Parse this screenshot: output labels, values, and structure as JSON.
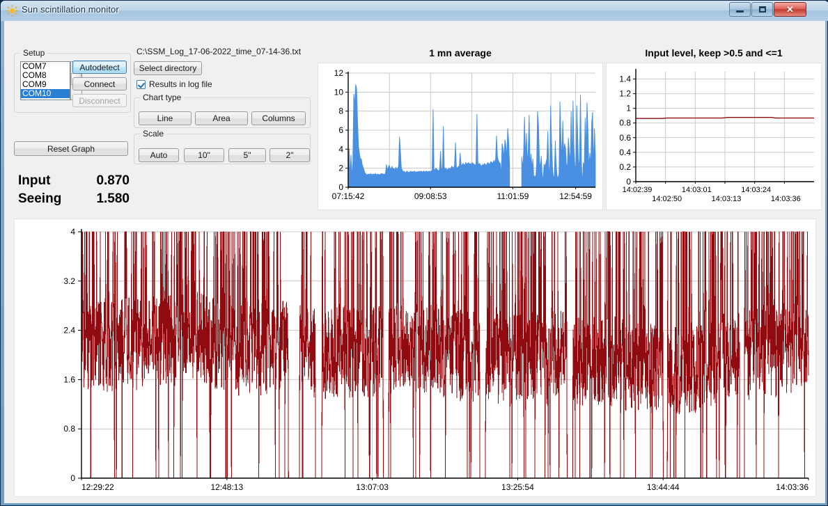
{
  "window": {
    "title": "Sun scintillation monitor",
    "icon": "sun-icon",
    "buttons": {
      "minimize": "minimize",
      "maximize": "maximize",
      "close": "close"
    }
  },
  "setup": {
    "group_label": "Setup",
    "ports": [
      "COM7",
      "COM8",
      "COM9",
      "COM10"
    ],
    "selected_port": "COM10",
    "autodetect_label": "Autodetect",
    "connect_label": "Connect",
    "disconnect_label": "Disconnect",
    "reset_graph_label": "Reset Graph"
  },
  "logging": {
    "path": "C:\\SSM_Log_17-06-2022_time_07-14-36.txt",
    "select_directory_label": "Select directory",
    "results_checkbox_label": "Results in log file",
    "results_checked": true
  },
  "chart_type": {
    "group_label": "Chart type",
    "buttons": [
      "Line",
      "Area",
      "Columns"
    ]
  },
  "scale": {
    "group_label": "Scale",
    "buttons": [
      "Auto",
      "10\"",
      "5\"",
      "2\""
    ]
  },
  "readouts": [
    {
      "label": "Input",
      "value": "0.870"
    },
    {
      "label": "Seeing",
      "value": "1.580"
    }
  ],
  "colors": {
    "series_blue": "#4a90e2",
    "series_darkred": "#8f0b10",
    "grid": "#c8c8c8",
    "axis": "#000000",
    "panel_bg": "#ffffff",
    "window_bg": "#f0f0f0",
    "selection": "#2a7fd4",
    "focus_border": "#3c7fb1"
  },
  "chart_data": [
    {
      "id": "one-minute-average",
      "type": "area",
      "title": "1 mn average",
      "xlabel": "",
      "ylabel": "",
      "ylim": [
        0,
        12
      ],
      "yticks": [
        0,
        2,
        4,
        6,
        8,
        10,
        12
      ],
      "xticks": [
        "07:15:42",
        "09:08:53",
        "11:01:59",
        "12:54:59"
      ],
      "xtick_positions": [
        0.0,
        0.333,
        0.666,
        0.92
      ],
      "grid": true,
      "color": "#4a90e2",
      "x_range": [
        "07:15:42",
        "13:45:00"
      ],
      "values": [
        0.6,
        4.1,
        1.2,
        3.4,
        1.0,
        2.7,
        9.8,
        8.6,
        10.8,
        10.4,
        7.2,
        4.3,
        3.6,
        2.9,
        3.0,
        2.4,
        2.1,
        1.8,
        1.5,
        1.4,
        1.3,
        1.35,
        1.4,
        1.3,
        1.45,
        1.3,
        1.35,
        1.4,
        1.3,
        1.45,
        1.35,
        1.3,
        1.4,
        1.3,
        1.35,
        1.4,
        1.45,
        1.35,
        1.4,
        1.3,
        1.5,
        2.4,
        1.8,
        2.1,
        2.3,
        2.0,
        1.9,
        2.2,
        1.9,
        2.0,
        1.8,
        2.1,
        1.9,
        2.0,
        2.2,
        5.3,
        3.8,
        2.0,
        1.8,
        1.6,
        1.7,
        1.5,
        1.6,
        1.7,
        1.6,
        1.55,
        1.6,
        1.7,
        1.6,
        1.65,
        1.6,
        1.7,
        1.6,
        1.55,
        1.65,
        1.6,
        1.7,
        1.6,
        1.7,
        1.65,
        1.6,
        1.7,
        1.6,
        1.65,
        1.7,
        1.6,
        1.65,
        1.7,
        1.6,
        1.7,
        1.8,
        8.2,
        1.9,
        1.8,
        2.0,
        1.9,
        1.8,
        1.7,
        1.9,
        3.8,
        2.0,
        1.9,
        6.4,
        2.1,
        1.9,
        2.0,
        1.8,
        1.9,
        2.0,
        1.9,
        2.0,
        2.2,
        2.1,
        2.0,
        2.3,
        4.7,
        2.1,
        2.0,
        2.2,
        2.1,
        3.6,
        2.4,
        2.3,
        2.5,
        2.4,
        2.3,
        2.6,
        2.4,
        2.5,
        2.6,
        2.4,
        2.5,
        2.4,
        2.6,
        2.5,
        2.4,
        2.3,
        2.5,
        7.7,
        2.6,
        2.4,
        2.5,
        2.3,
        2.2,
        2.4,
        2.3,
        2.5,
        2.4,
        2.3,
        2.5,
        2.6,
        2.4,
        2.5,
        2.7,
        2.6,
        2.5,
        2.8,
        2.6,
        3.0,
        5.4,
        3.2,
        2.8,
        2.6,
        2.5,
        1.3,
        4.6,
        4.1,
        3.0,
        5.0,
        4.4,
        3.1,
        6.2,
        4.9,
        2.4,
        null,
        null,
        null,
        null,
        null,
        null,
        null,
        null,
        null,
        null,
        null,
        null,
        3.2,
        2.0,
        3.5,
        7.4,
        3.0,
        5.7,
        2.5,
        4.0,
        7.6,
        2.2,
        3.5,
        2.0,
        3.0,
        1.0,
        1.2,
        1.0,
        2.4,
        8.0,
        6.5,
        2.8,
        2.0,
        3.3,
        1.2,
        1.0,
        2.4,
        2.2,
        2.6,
        3.0,
        5.9,
        2.4,
        1.0,
        8.6,
        4.8,
        2.1,
        1.0,
        1.2,
        4.9,
        2.3,
        1.1,
        1.0,
        1.4,
        9.0,
        5.4,
        2.9,
        7.0,
        3.5,
        4.6,
        4.1,
        2.2,
        2.4,
        5.2,
        3.8,
        2.4,
        8.0,
        2.5,
        9.1,
        4.0,
        2.3,
        1.9,
        8.6,
        5.6,
        2.0,
        3.0,
        9.7,
        2.6,
        0.3,
        2.6,
        2.0,
        7.3,
        4.0,
        8.9,
        6.0,
        2.0,
        3.6,
        2.2,
        6.8,
        7.9,
        2.0,
        6.2,
        3.2
      ]
    },
    {
      "id": "input-level",
      "type": "line",
      "title": "Input level, keep >0.5 and <=1",
      "xlabel": "",
      "ylabel": "",
      "ylim": [
        0,
        1.5
      ],
      "yticks": [
        0,
        0.2,
        0.4,
        0.6,
        0.8,
        1,
        1.2,
        1.4
      ],
      "xticks_row1": [
        "14:02:39",
        "14:03:01",
        "14:03:24"
      ],
      "xticks_row2": [
        "14:02:50",
        "14:03:13",
        "14:03:36"
      ],
      "grid": true,
      "color": "#8f0b10",
      "values": [
        0.862,
        0.862,
        0.862,
        0.862,
        0.862,
        0.862,
        0.862,
        0.862,
        0.862,
        0.862,
        0.864,
        0.868,
        0.868,
        0.868,
        0.868,
        0.868,
        0.868,
        0.868,
        0.868,
        0.868,
        0.868,
        0.868,
        0.868,
        0.868,
        0.868,
        0.868,
        0.868,
        0.868,
        0.868,
        0.868,
        0.868,
        0.868,
        0.872,
        0.876,
        0.876,
        0.876,
        0.876,
        0.876,
        0.876,
        0.876,
        0.876,
        0.876,
        0.876,
        0.876,
        0.876,
        0.876,
        0.876,
        0.876,
        0.876,
        0.876,
        0.868,
        0.868,
        0.868,
        0.868,
        0.868,
        0.868,
        0.868,
        0.868,
        0.868,
        0.868,
        0.868,
        0.868,
        0.868,
        0.868,
        0.868
      ]
    },
    {
      "id": "seeing-main",
      "type": "line",
      "title": "",
      "xlabel": "",
      "ylabel": "",
      "ylim": [
        0,
        4
      ],
      "yticks": [
        0,
        0.8,
        1.6,
        2.4,
        3.2,
        4
      ],
      "xticks": [
        "12:29:22",
        "12:48:13",
        "13:07:03",
        "13:25:54",
        "13:44:44",
        "14:03:36"
      ],
      "grid": true,
      "color": "#8f0b10",
      "note": "high-frequency seeing trace, values mostly 1.2-4.0 with frequent dropouts to 0",
      "seed": 20220617
    }
  ]
}
